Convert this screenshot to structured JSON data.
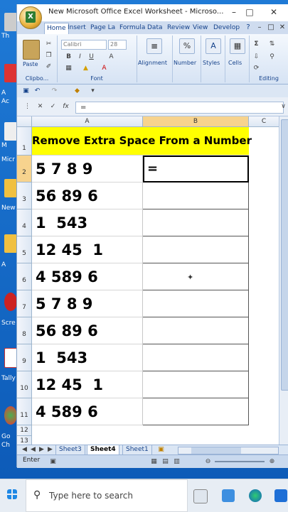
{
  "window": {
    "title": "New Microsoft Office Excel Worksheet - Microso..."
  },
  "ribbon_tabs": [
    "Home",
    "Insert",
    "Page La",
    "Formula",
    "Data",
    "Review",
    "View",
    "Develop"
  ],
  "ribbon": {
    "paste_label": "Paste",
    "clipboard_label": "Clipbo...",
    "font_name": "Calibri",
    "font_size": "28",
    "font_label": "Font",
    "alignment_label": "Alignment",
    "number_label": "Number",
    "styles_label": "Styles",
    "cells_label": "Cells",
    "editing_label": "Editing"
  },
  "formula_bar": {
    "value": "="
  },
  "columns": [
    "A",
    "B",
    "C"
  ],
  "rows": [
    {
      "num": "1",
      "a": "Remove Extra Space From a Number",
      "b": ""
    },
    {
      "num": "2",
      "a": "5 7 8 9",
      "b": "="
    },
    {
      "num": "3",
      "a": "56 89 6",
      "b": ""
    },
    {
      "num": "4",
      "a": "1  543",
      "b": ""
    },
    {
      "num": "5",
      "a": "12 45  1",
      "b": ""
    },
    {
      "num": "6",
      "a": "4 589 6",
      "b": ""
    },
    {
      "num": "7",
      "a": "5 7 8 9",
      "b": ""
    },
    {
      "num": "8",
      "a": "56 89 6",
      "b": ""
    },
    {
      "num": "9",
      "a": "1  543",
      "b": ""
    },
    {
      "num": "10",
      "a": "12 45  1",
      "b": ""
    },
    {
      "num": "11",
      "a": "4 589 6",
      "b": ""
    },
    {
      "num": "12",
      "a": "",
      "b": ""
    },
    {
      "num": "13",
      "a": "",
      "b": ""
    }
  ],
  "sheets": [
    "Sheet3",
    "Sheet4",
    "Sheet1"
  ],
  "active_sheet": "Sheet4",
  "status": {
    "mode": "Enter"
  },
  "taskbar": {
    "search_placeholder": "Type here to search"
  },
  "desktop_labels": [
    "Th",
    "A",
    "Ac",
    "M",
    "Micr",
    "New",
    "A",
    "Scre",
    "Tally",
    "Go",
    "Ch"
  ],
  "colors": {
    "header_fill": "#ffff00",
    "accent": "#15428b"
  }
}
